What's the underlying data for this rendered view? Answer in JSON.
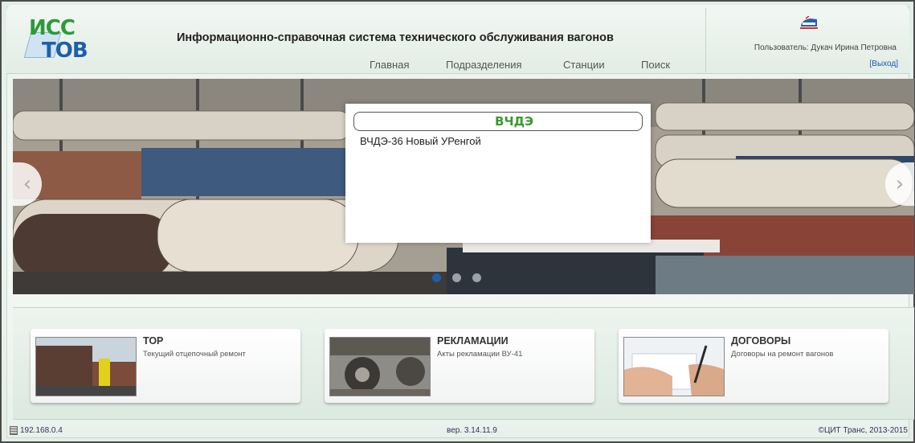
{
  "app": {
    "title": "Информационно-справочная система технического обслуживания вагонов",
    "logo_line1": "ИСС",
    "logo_line2": "ТОВ"
  },
  "nav": {
    "items": [
      "Главная",
      "Подразделения",
      "Станции",
      "Поиск"
    ]
  },
  "user": {
    "label": "Пользователь: Дукач Ирина Петровна",
    "logout": "[Выход]"
  },
  "carousel": {
    "popup_title": "ВЧДЭ",
    "popup_items": [
      "ВЧДЭ-36 Новый УРенгой"
    ],
    "prev": "‹",
    "next": "›",
    "active_slide": 1,
    "slides_count": 3
  },
  "cards": [
    {
      "title": "ТОР",
      "subtitle": "Текущий отцепочный ремонт",
      "image": "wagon-repair-photo"
    },
    {
      "title": "РЕКЛАМАЦИИ",
      "subtitle": "Акты рекламации ВУ-41",
      "image": "wheelset-photo"
    },
    {
      "title": "ДОГОВОРЫ",
      "subtitle": "Договоры на ремонт вагонов",
      "image": "contract-signing-photo"
    }
  ],
  "footer": {
    "ip": "192.168.0.4",
    "version": "вер. 3.14.11.9",
    "copyright": "©ЦИТ Транс, 2013-2015"
  },
  "colors": {
    "accent_green": "#3a9a2d",
    "link_blue": "#1a55b5",
    "active_dot": "#1e5ea8"
  }
}
